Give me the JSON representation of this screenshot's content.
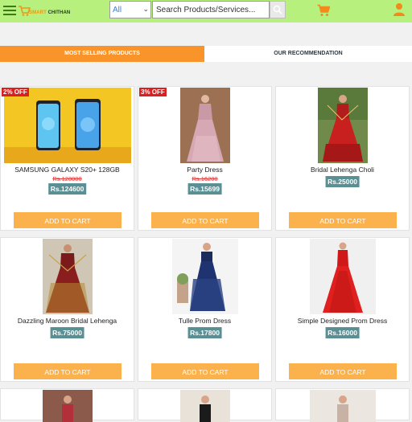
{
  "header": {
    "logo_text_1": "SMART",
    "logo_text_2": "CHITHAN",
    "category_selected": "All",
    "search_placeholder": "Search Products/Services..."
  },
  "tabs": [
    {
      "label": "MOST SELLING PRODUCTS",
      "active": true
    },
    {
      "label": "OUR RECOMMENDATION",
      "active": false
    }
  ],
  "products": [
    {
      "name": "SAMSUNG GALAXY S20+ 128GB",
      "badge": "2% OFF",
      "old_price": "Rs.128000",
      "price": "Rs.124600",
      "button": "ADD TO CART"
    },
    {
      "name": "Party Dress",
      "badge": "3% OFF",
      "old_price": "Rs.16200",
      "price": "Rs.15699",
      "button": "ADD TO CART"
    },
    {
      "name": "Bridal Lehenga Choli",
      "price": "Rs.25000",
      "button": "ADD TO CART"
    },
    {
      "name": "Dazzling Maroon Bridal Lehenga",
      "price": "Rs.75000",
      "button": "ADD TO CART"
    },
    {
      "name": "Tulle Prom Dress",
      "price": "Rs.17800",
      "button": "ADD TO CART"
    },
    {
      "name": "Simple Designed Prom Dress",
      "price": "Rs.16000",
      "button": "ADD TO CART"
    }
  ],
  "colors": {
    "topbar": "#b8f07e",
    "tab_active": "#f9942b",
    "add_button": "#fbb24c",
    "price_badge": "#5a8f94",
    "discount_badge": "#d92121"
  }
}
